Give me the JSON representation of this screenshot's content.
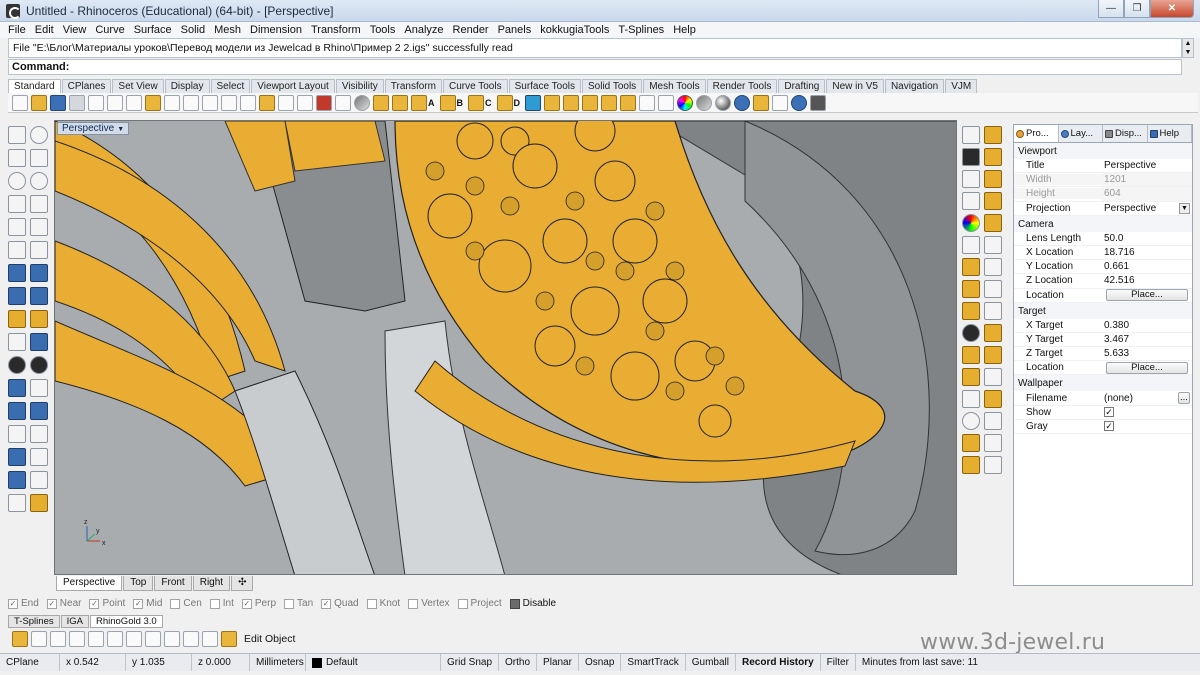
{
  "window": {
    "title": "Untitled - Rhinoceros (Educational) (64-bit) - [Perspective]",
    "controls": [
      "—",
      "❐",
      "✕"
    ]
  },
  "menu": [
    "File",
    "Edit",
    "View",
    "Curve",
    "Surface",
    "Solid",
    "Mesh",
    "Dimension",
    "Transform",
    "Tools",
    "Analyze",
    "Render",
    "Panels",
    "kokkugiaTools",
    "T-Splines",
    "Help"
  ],
  "command_history": "File \"E:\\Блог\\Материалы уроков\\Перевод модели из Jewelcad в Rhino\\Пример 2 2.igs\" successfully read",
  "command_prompt": "Command:",
  "toolbar_tabs": [
    "Standard",
    "CPlanes",
    "Set View",
    "Display",
    "Select",
    "Viewport Layout",
    "Visibility",
    "Transform",
    "Curve Tools",
    "Surface Tools",
    "Solid Tools",
    "Mesh Tools",
    "Render Tools",
    "Drafting",
    "New in V5",
    "Navigation",
    "VJM"
  ],
  "toolbar_letters": [
    "A",
    "B",
    "C",
    "D"
  ],
  "viewport": {
    "label": "Perspective",
    "tabs": [
      "Perspective",
      "Top",
      "Front",
      "Right"
    ],
    "add_tab": "✣",
    "axes": {
      "x": "x",
      "y": "y",
      "z": "z"
    },
    "colors": {
      "background": "#a7abae",
      "gold": "#e8ad32",
      "silver": "#c9ccce",
      "dark": "#7c8083"
    }
  },
  "panel": {
    "tabs": [
      "Pro...",
      "Lay...",
      "Disp...",
      "Help"
    ],
    "sections": {
      "viewport": "Viewport",
      "camera": "Camera",
      "target": "Target",
      "wallpaper": "Wallpaper"
    },
    "viewport_rows": [
      {
        "key": "Title",
        "value": "Perspective"
      },
      {
        "key": "Width",
        "value": "1201"
      },
      {
        "key": "Height",
        "value": "604"
      },
      {
        "key": "Projection",
        "value": "Perspective"
      }
    ],
    "camera_rows": [
      {
        "key": "Lens Length",
        "value": "50.0"
      },
      {
        "key": "X Location",
        "value": "18.716"
      },
      {
        "key": "Y Location",
        "value": "0.661"
      },
      {
        "key": "Z Location",
        "value": "42.516"
      },
      {
        "key": "Location",
        "value": "Place..."
      }
    ],
    "target_rows": [
      {
        "key": "X Target",
        "value": "0.380"
      },
      {
        "key": "Y Target",
        "value": "3.467"
      },
      {
        "key": "Z Target",
        "value": "5.633"
      },
      {
        "key": "Location",
        "value": "Place..."
      }
    ],
    "wallpaper_rows": [
      {
        "key": "Filename",
        "value": "(none)",
        "button": "..."
      },
      {
        "key": "Show",
        "value": "✓"
      },
      {
        "key": "Gray",
        "value": "✓"
      }
    ]
  },
  "osnap": [
    {
      "label": "End",
      "checked": true
    },
    {
      "label": "Near",
      "checked": true
    },
    {
      "label": "Point",
      "checked": true
    },
    {
      "label": "Mid",
      "checked": true
    },
    {
      "label": "Cen",
      "checked": false
    },
    {
      "label": "Int",
      "checked": false
    },
    {
      "label": "Perp",
      "checked": true
    },
    {
      "label": "Tan",
      "checked": false
    },
    {
      "label": "Quad",
      "checked": true
    },
    {
      "label": "Knot",
      "checked": false
    },
    {
      "label": "Vertex",
      "checked": false
    },
    {
      "label": "Project",
      "checked": false
    }
  ],
  "osnap_disable": "Disable",
  "bottom_tabs": [
    "T-Splines",
    "IGA",
    "RhinoGold 3.0"
  ],
  "bottom_toolbar_label": "Edit Object",
  "watermark": "www.3d-jewel.ru",
  "status": {
    "cplane": "CPlane",
    "x": "x 0.542",
    "y": "y 1.035",
    "z": "z 0.000",
    "units": "Millimeters",
    "layer": "Default",
    "layer_color": "#000000",
    "toggles": [
      "Grid Snap",
      "Ortho",
      "Planar",
      "Osnap",
      "SmartTrack",
      "Gumball",
      "Record History",
      "Filter"
    ],
    "bold_toggle": "Record History",
    "last_save": "Minutes from last save: 11"
  }
}
